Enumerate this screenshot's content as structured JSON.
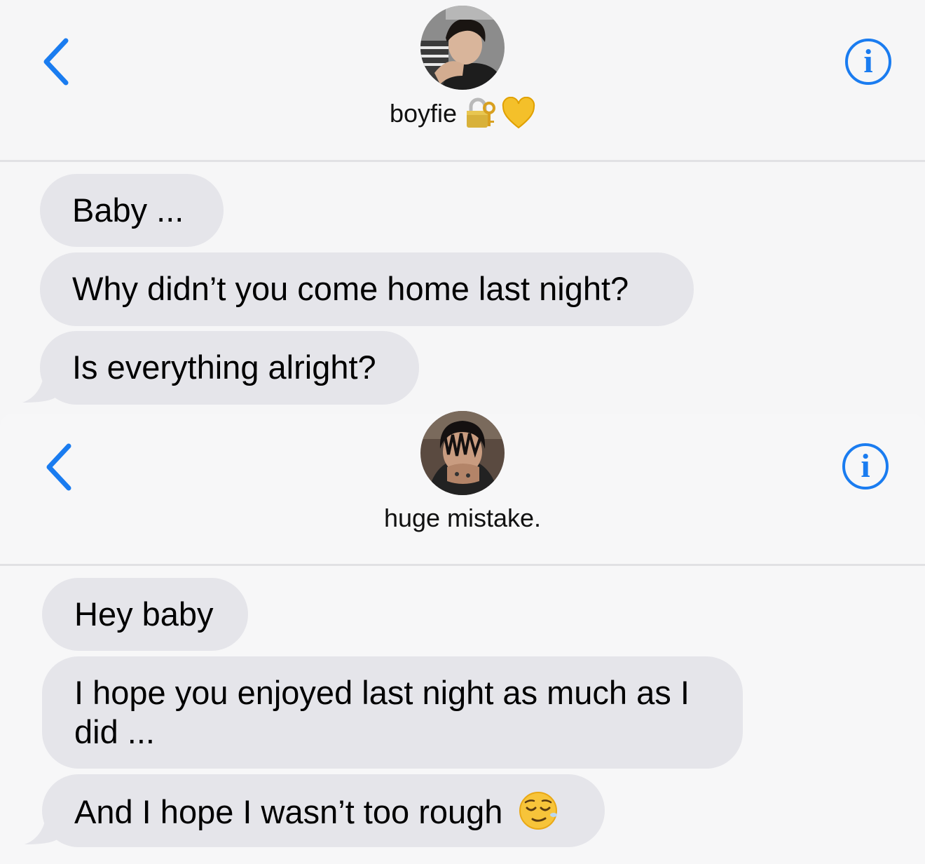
{
  "conversations": [
    {
      "contact_name": "boyfie",
      "contact_emojis": [
        "lock-with-key-icon",
        "yellow-heart-icon"
      ],
      "avatar": "contact-avatar-photo",
      "messages": [
        {
          "text": "Baby ..."
        },
        {
          "text": "Why didn’t you come home last night?"
        },
        {
          "text": "Is everything alright?"
        }
      ]
    },
    {
      "contact_name": "huge mistake.",
      "avatar": "contact-avatar-photo",
      "messages": [
        {
          "text": "Hey baby"
        },
        {
          "text": "I hope you enjoyed last night as much as I did ..."
        },
        {
          "text": "And I hope I wasn’t too rough",
          "emoji": "relieved-face-icon"
        }
      ]
    }
  ],
  "icons": {
    "back": "chevron-left-icon",
    "info": "info-icon",
    "info_glyph": "i"
  },
  "colors": {
    "accent": "#1a7cf0",
    "bubble_received": "#e5e5ea",
    "background": "#f6f6f7"
  }
}
